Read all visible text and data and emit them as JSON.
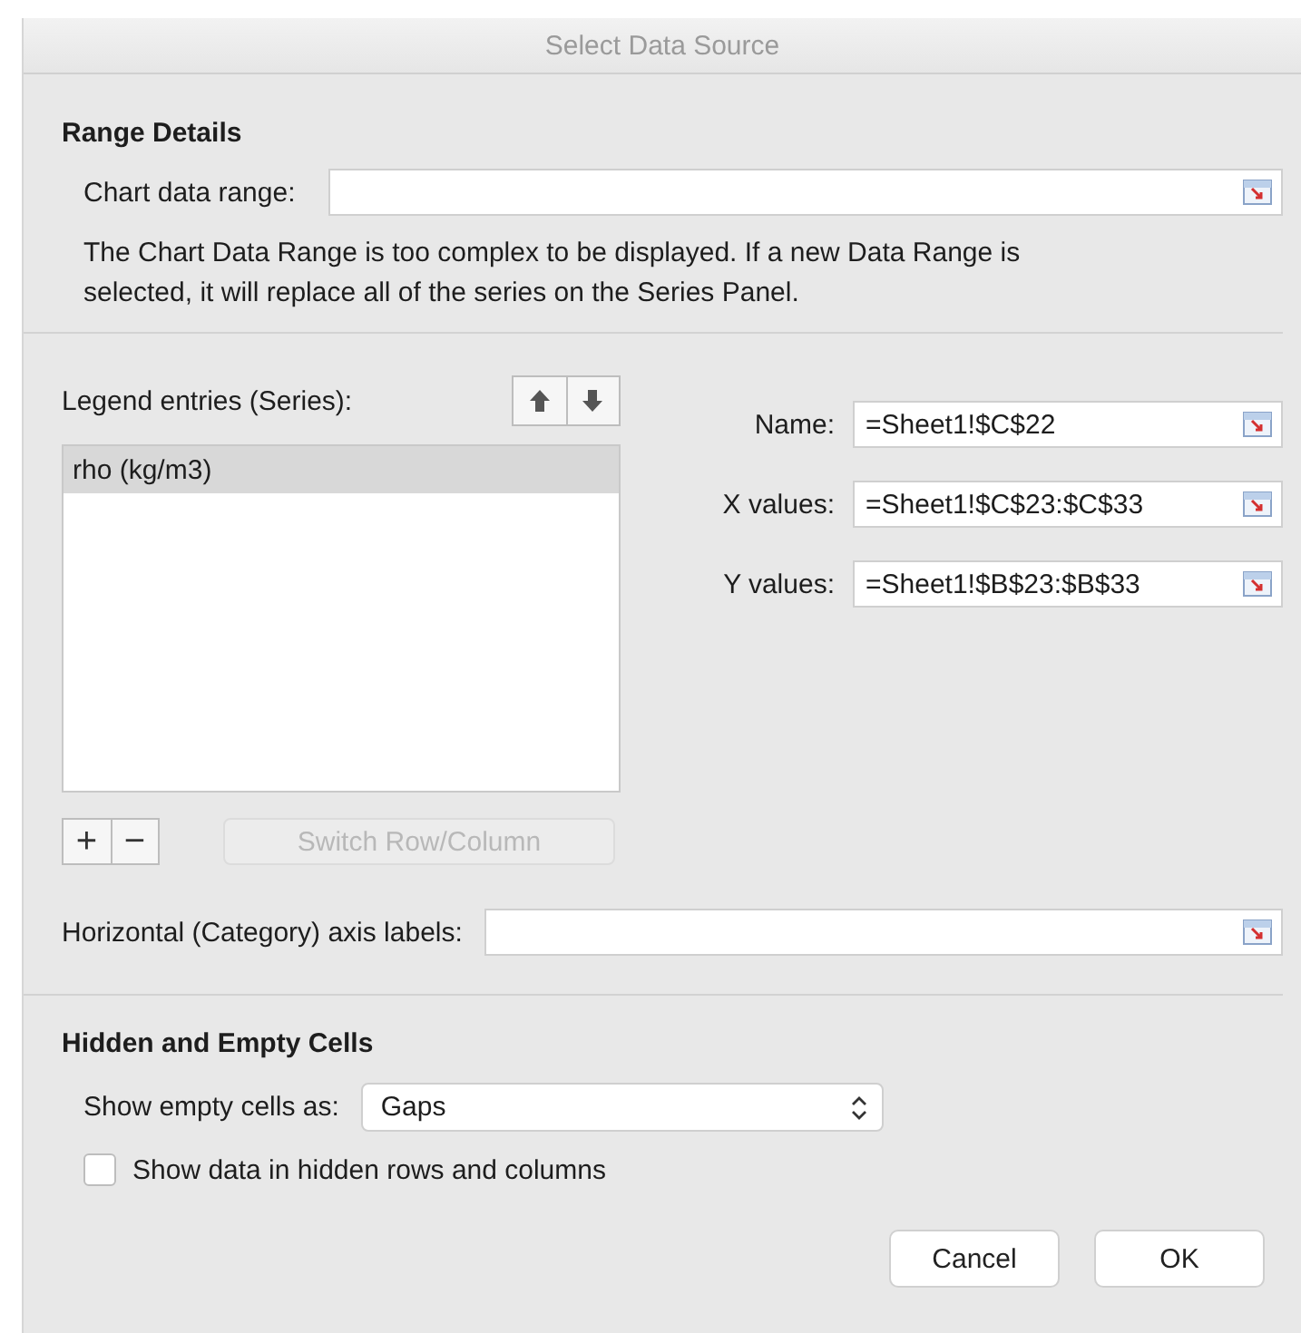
{
  "window": {
    "title": "Select Data Source"
  },
  "range_details": {
    "heading": "Range Details",
    "label": "Chart data range:",
    "note": "The Chart Data Range is too complex to be displayed. If a new Data Range is selected, it will replace all of the series on the Series Panel."
  },
  "series": {
    "label": "Legend entries (Series):",
    "items": [
      {
        "label": "rho (kg/m3)",
        "selected": true
      }
    ],
    "add": "+",
    "remove": "−",
    "switch": {
      "label": "Switch Row/Column",
      "disabled": true
    }
  },
  "fields": [
    {
      "label": "Name:",
      "value": "=Sheet1!$C$22"
    },
    {
      "label": "X values:",
      "value": "=Sheet1!$C$23:$C$33"
    },
    {
      "label": "Y values:",
      "value": "=Sheet1!$B$23:$B$33"
    }
  ],
  "axis_labels": {
    "label": "Horizontal (Category) axis labels:"
  },
  "hidden_cells": {
    "heading": "Hidden and Empty Cells",
    "label": "Show empty cells as:",
    "value": "Gaps",
    "checkbox": {
      "label": "Show data in hidden rows and columns",
      "checked": false
    }
  },
  "buttons": [
    "Cancel",
    "OK"
  ]
}
